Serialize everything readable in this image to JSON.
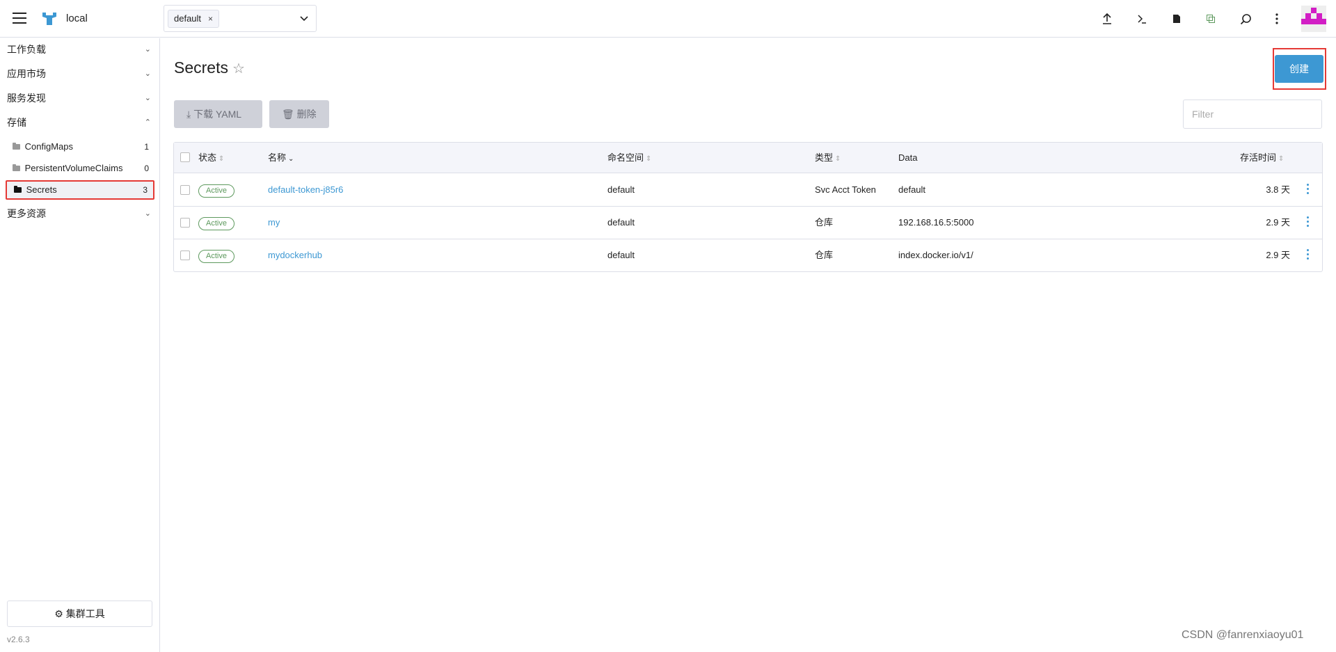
{
  "header": {
    "cluster_name": "local",
    "namespace_tag": "default",
    "namespace_tag_remove": "×",
    "icons": [
      "upload-icon",
      "terminal-icon",
      "file-icon",
      "copy-icon",
      "search-icon",
      "kebab-icon"
    ]
  },
  "sidebar": {
    "groups": [
      {
        "label": "工作负载",
        "expanded": false
      },
      {
        "label": "应用市场",
        "expanded": false
      },
      {
        "label": "服务发现",
        "expanded": false
      },
      {
        "label": "存储",
        "expanded": true
      },
      {
        "label": "更多资源",
        "expanded": false
      }
    ],
    "storage_items": [
      {
        "label": "ConfigMaps",
        "count": "1"
      },
      {
        "label": "PersistentVolumeClaims",
        "count": "0"
      },
      {
        "label": "Secrets",
        "count": "3"
      }
    ],
    "cluster_tools": "集群工具",
    "version": "v2.6.3"
  },
  "main": {
    "title": "Secrets",
    "create_label": "创建",
    "download_yaml": "下载 YAML",
    "delete_label": "删除",
    "filter_placeholder": "Filter",
    "columns": [
      "状态",
      "名称",
      "命名空间",
      "类型",
      "Data",
      "存活时间"
    ],
    "rows": [
      {
        "state": "Active",
        "name": "default-token-j85r6",
        "namespace": "default",
        "type": "Svc Acct Token",
        "data": "default",
        "age": "3.8 天"
      },
      {
        "state": "Active",
        "name": "my",
        "namespace": "default",
        "type": "仓库",
        "data": "192.168.16.5:5000",
        "age": "2.9 天"
      },
      {
        "state": "Active",
        "name": "mydockerhub",
        "namespace": "default",
        "type": "仓库",
        "data": "index.docker.io/v1/",
        "age": "2.9 天"
      }
    ]
  },
  "watermark": "CSDN @fanrenxiaoyu01",
  "colors": {
    "accent": "#3d98d3",
    "active_badge": "#5d995d",
    "highlight": "#e53935"
  }
}
